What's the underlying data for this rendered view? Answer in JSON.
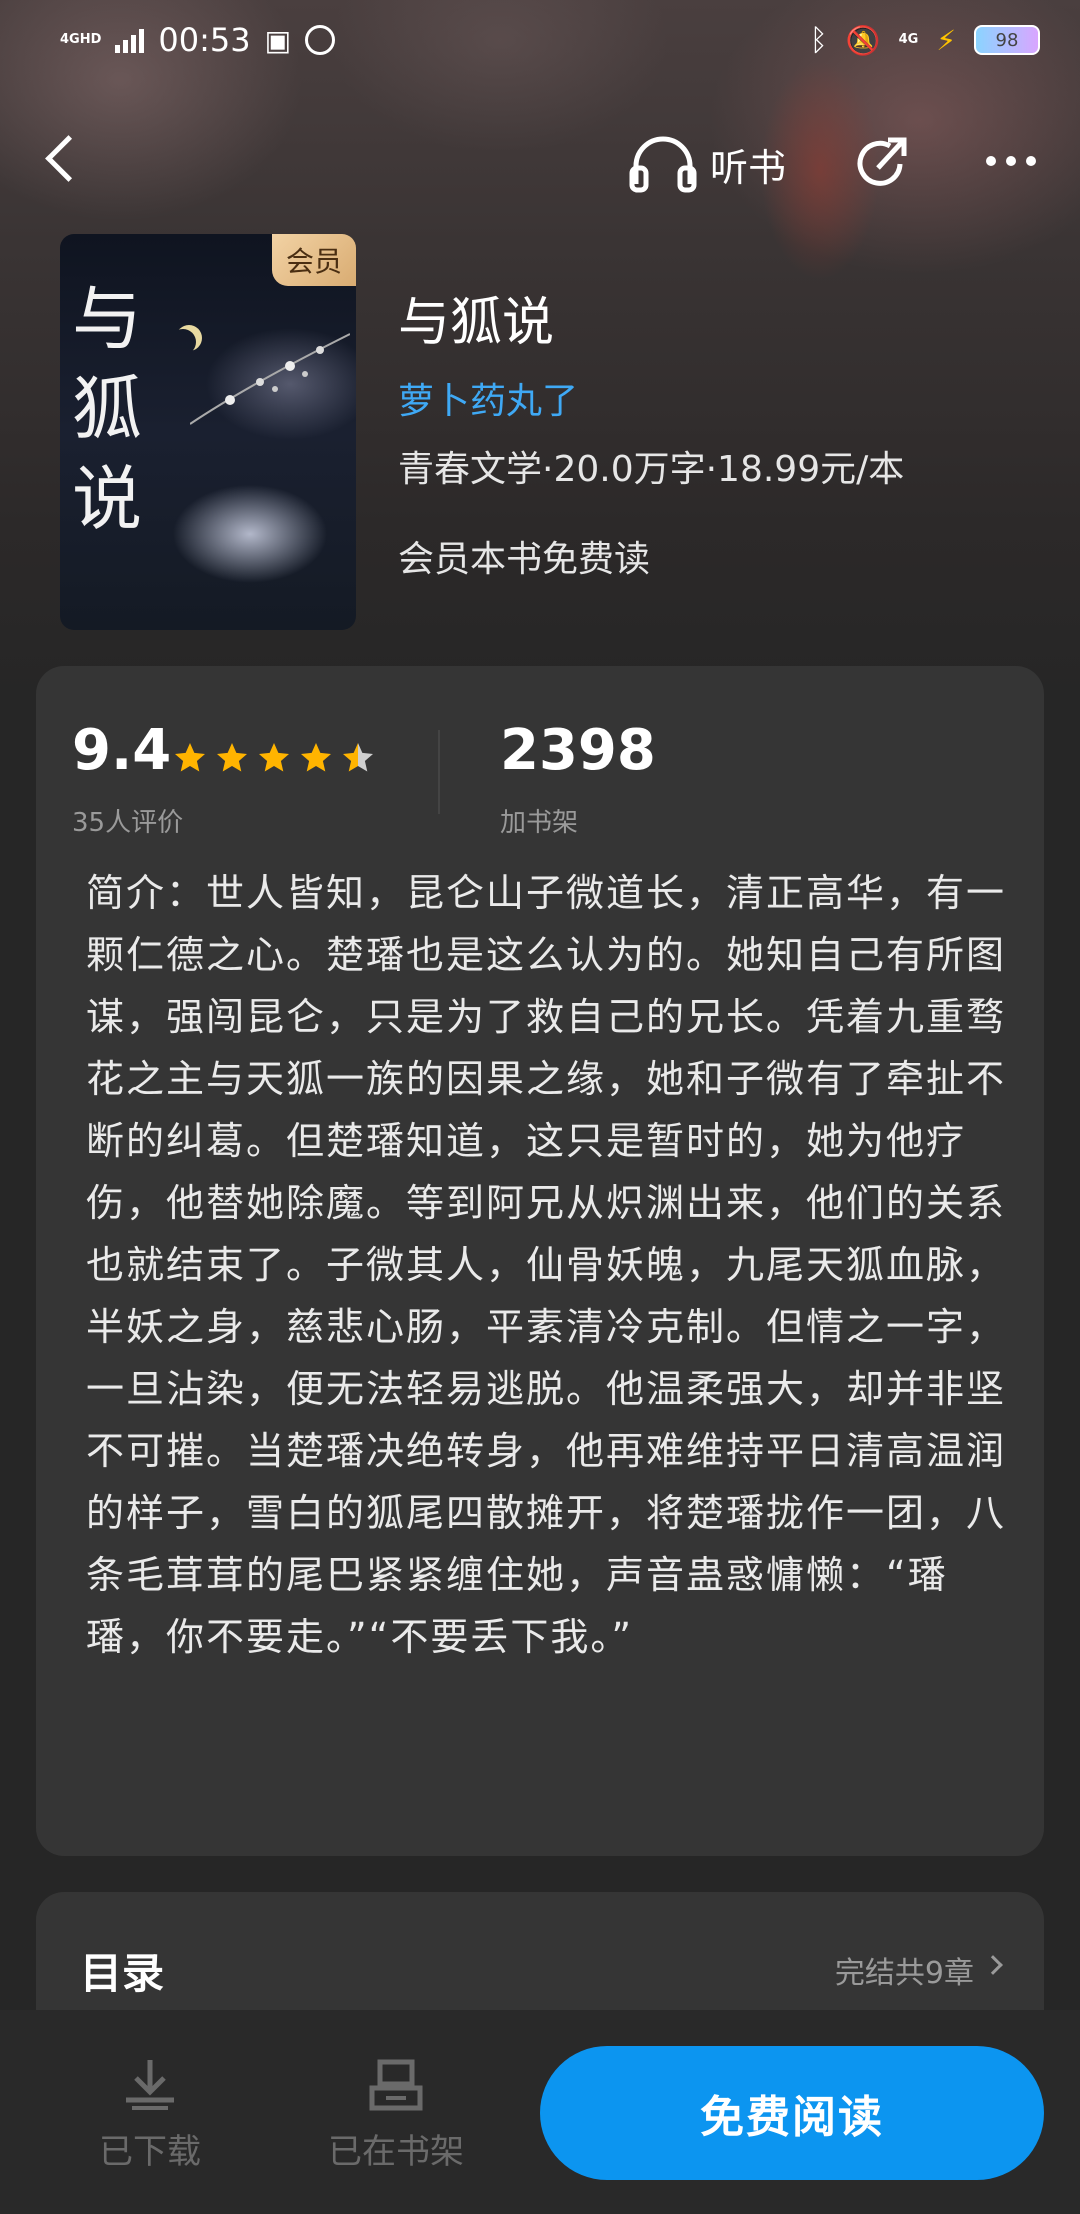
{
  "status_bar": {
    "network_tag": "4GHD",
    "time": "00:53",
    "network2_tag": "4G",
    "battery": "98"
  },
  "nav": {
    "listen_label": "听书"
  },
  "book": {
    "cover_title": "与狐说",
    "vip_badge": "会员",
    "title": "与狐说",
    "author": "萝卜药丸了",
    "meta": "青春文学·20.0万字·18.99元/本",
    "vip_note": "会员本书免费读"
  },
  "stats": {
    "score": "9.4",
    "stars": 4.5,
    "rating_count": "35人评价",
    "shelf_count": "2398",
    "shelf_label": "加书架"
  },
  "intro": "简介：世人皆知，昆仑山子微道长，清正高华，有一颗仁德之心。楚璠也是这么认为的。她知自己有所图谋，强闯昆仑，只是为了救自己的兄长。凭着九重骛花之主与天狐一族的因果之缘，她和子微有了牵扯不断的纠葛。但楚璠知道，这只是暂时的，她为他疗伤，他替她除魔。等到阿兄从炽渊出来，他们的关系也就结束了。子微其人，仙骨妖魄，九尾天狐血脉，半妖之身，慈悲心肠，平素清冷克制。但情之一字，一旦沾染，便无法轻易逃脱。他温柔强大，却并非坚不可摧。当楚璠决绝转身，他再难维持平日清高温润的样子，雪白的狐尾四散摊开，将楚璠拢作一团，八条毛茸茸的尾巴紧紧缠住她，声音蛊惑慵懒：“璠璠，你不要走。”“不要丢下我。”",
  "toc": {
    "title": "目录",
    "status": "完结共9章"
  },
  "bottom": {
    "downloaded_label": "已下载",
    "shelf_label": "已在书架",
    "read_label": "免费阅读"
  },
  "colors": {
    "accent": "#0c95f0",
    "author": "#3fa9f5",
    "star": "#ffb400",
    "vip_gold": "#d9ac72"
  }
}
